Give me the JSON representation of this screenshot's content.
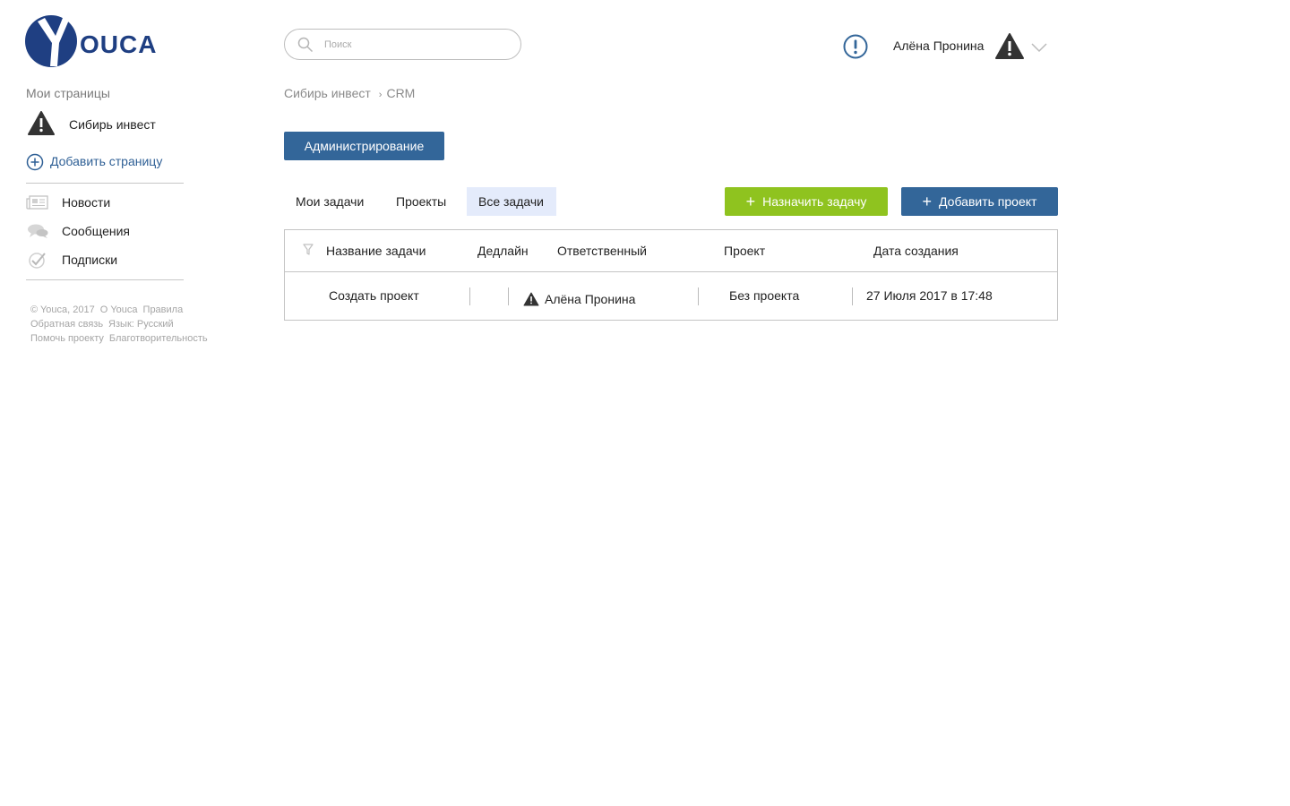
{
  "brand": {
    "logo_text": "OUCA",
    "primary_color": "#336699",
    "accent_color": "#8fc31f"
  },
  "search": {
    "placeholder": "Поиск",
    "value": ""
  },
  "header": {
    "user_name": "Алёна Пронина",
    "alert_icon": "exclamation-circle-icon",
    "avatar_icon": "warning-triangle-icon",
    "dropdown_icon": "chevron-down-icon"
  },
  "sidebar": {
    "my_pages_title": "Мои страницы",
    "pages": [
      {
        "label": "Сибирь инвест",
        "icon": "warning-triangle-icon"
      }
    ],
    "add_page_label": "Добавить страницу",
    "nav": [
      {
        "label": "Новости",
        "icon": "newspaper-icon"
      },
      {
        "label": "Сообщения",
        "icon": "chat-bubbles-icon"
      },
      {
        "label": "Подписки",
        "icon": "check-circle-icon"
      }
    ],
    "footer": {
      "links": [
        "© Youca, 2017",
        "О Youca",
        "Правила",
        "Обратная связь",
        "Язык: Русский",
        "Помочь проекту",
        "Благотворительность"
      ]
    }
  },
  "breadcrumb": {
    "items": [
      "Сибирь инвест",
      "CRM"
    ],
    "separator": "›"
  },
  "main": {
    "admin_button": "Администрирование",
    "tabs": [
      {
        "label": "Мои задачи",
        "active": false
      },
      {
        "label": "Проекты",
        "active": false
      },
      {
        "label": "Все задачи",
        "active": true
      }
    ],
    "assign_task_button": "Назначить задачу",
    "add_project_button": "Добавить проект",
    "table": {
      "columns": [
        "Название задачи",
        "Дедлайн",
        "Ответственный",
        "Проект",
        "Дата создания"
      ],
      "rows": [
        {
          "name": "Создать проект",
          "deadline": "",
          "responsible": "Алёна Пронина",
          "project": "Без проекта",
          "created": "27 Июля 2017 в 17:48"
        }
      ]
    }
  }
}
